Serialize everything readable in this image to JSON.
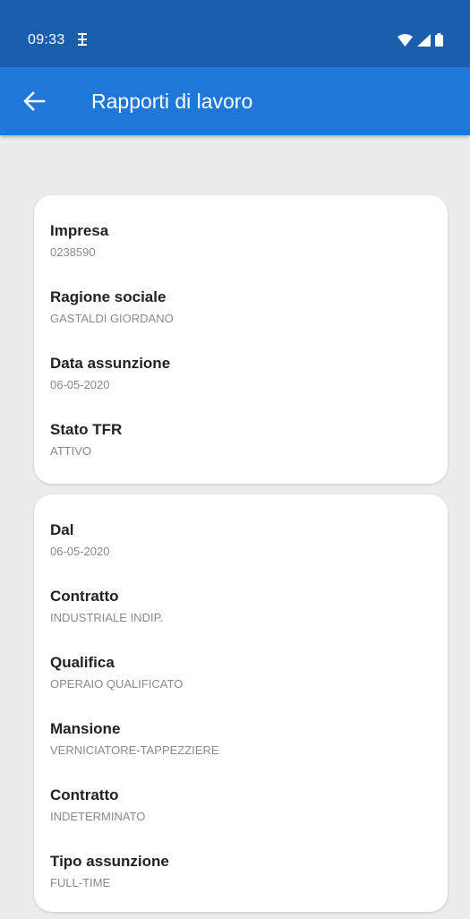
{
  "status_bar": {
    "time": "09:33",
    "app_icon_glyph": "Ж",
    "icons": [
      "wifi-icon",
      "signal-icon",
      "battery-icon"
    ]
  },
  "app_bar": {
    "title": "Rapporti di lavoro",
    "back_icon": "arrow-back-icon"
  },
  "colors": {
    "status_bar": "#1a5fae",
    "app_bar": "#1f77d8",
    "background": "#ececec",
    "card": "#ffffff",
    "label": "#222222",
    "value": "#8a8a8a"
  },
  "company_card": {
    "fields": [
      {
        "label": "Impresa",
        "value": "0238590"
      },
      {
        "label": "Ragione sociale",
        "value": "GASTALDI GIORDANO"
      },
      {
        "label": "Data assunzione",
        "value": "06-05-2020"
      },
      {
        "label": "Stato TFR",
        "value": "ATTIVO"
      }
    ]
  },
  "contract_card": {
    "fields": [
      {
        "label": "Dal",
        "value": "06-05-2020"
      },
      {
        "label": "Contratto",
        "value": "INDUSTRIALE INDIP."
      },
      {
        "label": "Qualifica",
        "value": "OPERAIO QUALIFICATO"
      },
      {
        "label": "Mansione",
        "value": "VERNICIATORE-TAPPEZZIERE"
      },
      {
        "label": "Contratto",
        "value": "INDETERMINATO"
      },
      {
        "label": "Tipo assunzione",
        "value": "FULL-TIME"
      }
    ]
  }
}
